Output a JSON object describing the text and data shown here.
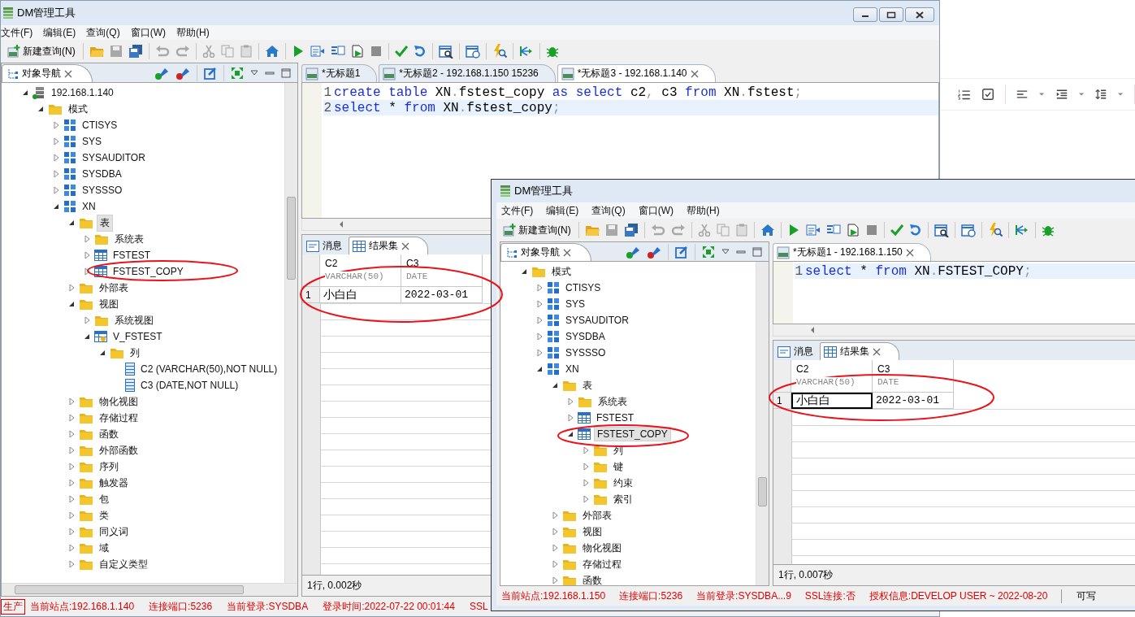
{
  "windows": [
    {
      "title": "DM管理工具",
      "title_buttons": true,
      "menu": [
        "文件(F)",
        "编辑(E)",
        "查询(Q)",
        "窗口(W)",
        "帮助(H)"
      ],
      "new_query": "新建查询(N)",
      "navigator": {
        "tab": "对象导航",
        "tree": [
          {
            "label": "192.168.1.140",
            "kind": "server",
            "expanded": true,
            "selected": false,
            "children": [
              {
                "label": "模式",
                "kind": "folder",
                "expanded": true,
                "selected": false,
                "children": [
                  {
                    "label": "CTISYS",
                    "kind": "schema",
                    "expanded": false,
                    "selected": false
                  },
                  {
                    "label": "SYS",
                    "kind": "schema",
                    "expanded": false,
                    "selected": false
                  },
                  {
                    "label": "SYSAUDITOR",
                    "kind": "schema",
                    "expanded": false,
                    "selected": false
                  },
                  {
                    "label": "SYSDBA",
                    "kind": "schema",
                    "expanded": false,
                    "selected": false
                  },
                  {
                    "label": "SYSSSO",
                    "kind": "schema",
                    "expanded": false,
                    "selected": false
                  },
                  {
                    "label": "XN",
                    "kind": "schema",
                    "expanded": true,
                    "selected": false,
                    "children": [
                      {
                        "label": "表",
                        "kind": "folder",
                        "expanded": true,
                        "selected": true,
                        "children": [
                          {
                            "label": "系统表",
                            "kind": "folder",
                            "expanded": false,
                            "selected": false
                          },
                          {
                            "label": "FSTEST",
                            "kind": "table",
                            "expanded": false,
                            "selected": false
                          },
                          {
                            "label": "FSTEST_COPY",
                            "kind": "table",
                            "expanded": false,
                            "selected": false
                          }
                        ]
                      },
                      {
                        "label": "外部表",
                        "kind": "folder",
                        "expanded": false,
                        "selected": false
                      },
                      {
                        "label": "视图",
                        "kind": "folder",
                        "expanded": true,
                        "selected": false,
                        "children": [
                          {
                            "label": "系统视图",
                            "kind": "folder",
                            "expanded": false,
                            "selected": false
                          },
                          {
                            "label": "V_FSTEST",
                            "kind": "view",
                            "expanded": true,
                            "selected": false,
                            "children": [
                              {
                                "label": "列",
                                "kind": "folder",
                                "expanded": true,
                                "selected": false,
                                "children": [
                                  {
                                    "label": "C2 (VARCHAR(50),NOT NULL)",
                                    "kind": "column",
                                    "selected": false
                                  },
                                  {
                                    "label": "C3 (DATE,NOT NULL)",
                                    "kind": "column",
                                    "selected": false
                                  }
                                ]
                              }
                            ]
                          }
                        ]
                      },
                      {
                        "label": "物化视图",
                        "kind": "folder",
                        "expanded": false,
                        "selected": false
                      },
                      {
                        "label": "存储过程",
                        "kind": "folder",
                        "expanded": false,
                        "selected": false
                      },
                      {
                        "label": "函数",
                        "kind": "folder",
                        "expanded": false,
                        "selected": false
                      },
                      {
                        "label": "外部函数",
                        "kind": "folder",
                        "expanded": false,
                        "selected": false
                      },
                      {
                        "label": "序列",
                        "kind": "folder",
                        "expanded": false,
                        "selected": false
                      },
                      {
                        "label": "触发器",
                        "kind": "folder",
                        "expanded": false,
                        "selected": false
                      },
                      {
                        "label": "包",
                        "kind": "folder",
                        "expanded": false,
                        "selected": false
                      },
                      {
                        "label": "类",
                        "kind": "folder",
                        "expanded": false,
                        "selected": false
                      },
                      {
                        "label": "同义词",
                        "kind": "folder",
                        "expanded": false,
                        "selected": false
                      },
                      {
                        "label": "域",
                        "kind": "folder",
                        "expanded": false,
                        "selected": false
                      },
                      {
                        "label": "自定义类型",
                        "kind": "folder",
                        "expanded": false,
                        "selected": false
                      }
                    ]
                  }
                ]
              }
            ]
          }
        ]
      },
      "editor": {
        "tabs": [
          {
            "label": "*无标题1",
            "selected": false
          },
          {
            "label": "*无标题2 - 192.168.1.150 15236",
            "selected": false
          },
          {
            "label": "*无标题3 - 192.168.1.140",
            "selected": true
          }
        ],
        "lines": [
          {
            "number": "1",
            "current": false,
            "tokens": [
              {
                "t": "create ",
                "kind": "keyword"
              },
              {
                "t": "table ",
                "kind": "keyword"
              },
              {
                "t": "XN",
                "kind": "plain"
              },
              {
                "t": ".",
                "kind": "punct"
              },
              {
                "t": "fstest_copy ",
                "kind": "plain"
              },
              {
                "t": "as ",
                "kind": "keyword"
              },
              {
                "t": "select ",
                "kind": "keyword"
              },
              {
                "t": "c2",
                "kind": "plain"
              },
              {
                "t": ",",
                "kind": "punct"
              },
              {
                "t": " c3 ",
                "kind": "plain"
              },
              {
                "t": "from",
                "kind": "keyword"
              },
              {
                "t": " XN",
                "kind": "plain"
              },
              {
                "t": ".",
                "kind": "punct"
              },
              {
                "t": "fstest",
                "kind": "plain"
              },
              {
                "t": ";",
                "kind": "punct"
              }
            ]
          },
          {
            "number": "2",
            "current": true,
            "tokens": [
              {
                "t": "select",
                "kind": "keyword"
              },
              {
                "t": " * ",
                "kind": "plain"
              },
              {
                "t": "from",
                "kind": "keyword"
              },
              {
                "t": " XN",
                "kind": "plain"
              },
              {
                "t": ".",
                "kind": "punct"
              },
              {
                "t": "fstest_copy",
                "kind": "plain"
              },
              {
                "t": ";",
                "kind": "punct"
              }
            ]
          }
        ]
      },
      "results": {
        "tabs": [
          {
            "label": "消息",
            "kind": "messages",
            "selected": false
          },
          {
            "label": "结果集",
            "kind": "resultset",
            "selected": true
          }
        ],
        "columns": [
          {
            "name": "C2",
            "type": "VARCHAR(50)"
          },
          {
            "name": "C3",
            "type": "DATE"
          }
        ],
        "rows": [
          {
            "number": "1",
            "cells": [
              {
                "text": "小白白",
                "selected": false
              },
              {
                "text": "2022-03-01",
                "selected": false
              }
            ]
          }
        ],
        "status": "1行, 0.002秒"
      },
      "status_bar": [
        {
          "text": "生产",
          "kind": "badge"
        },
        {
          "text": "当前站点:192.168.1.140",
          "kind": "info"
        },
        {
          "text": "连接端口:5236",
          "kind": "info"
        },
        {
          "text": "当前登录:SYSDBA",
          "kind": "info"
        },
        {
          "text": "登录时间:2022-07-22 00:01:44",
          "kind": "info"
        },
        {
          "text": "SSL",
          "kind": "info"
        }
      ]
    },
    {
      "title": "DM管理工具",
      "title_buttons": false,
      "menu": [
        "文件(F)",
        "编辑(E)",
        "查询(Q)",
        "窗口(W)",
        "帮助(H)"
      ],
      "new_query": "新建查询(N)",
      "navigator": {
        "tab": "对象导航",
        "tree": [
          {
            "label": "模式",
            "kind": "folder",
            "expanded": true,
            "selected": false,
            "children": [
              {
                "label": "CTISYS",
                "kind": "schema",
                "expanded": false,
                "selected": false
              },
              {
                "label": "SYS",
                "kind": "schema",
                "expanded": false,
                "selected": false
              },
              {
                "label": "SYSAUDITOR",
                "kind": "schema",
                "expanded": false,
                "selected": false
              },
              {
                "label": "SYSDBA",
                "kind": "schema",
                "expanded": false,
                "selected": false
              },
              {
                "label": "SYSSSO",
                "kind": "schema",
                "expanded": false,
                "selected": false
              },
              {
                "label": "XN",
                "kind": "schema",
                "expanded": true,
                "selected": false,
                "children": [
                  {
                    "label": "表",
                    "kind": "folder",
                    "expanded": true,
                    "selected": false,
                    "children": [
                      {
                        "label": "系统表",
                        "kind": "folder",
                        "expanded": false,
                        "selected": false
                      },
                      {
                        "label": "FSTEST",
                        "kind": "table",
                        "expanded": false,
                        "selected": false
                      },
                      {
                        "label": "FSTEST_COPY",
                        "kind": "table",
                        "expanded": true,
                        "selected": true,
                        "children": [
                          {
                            "label": "列",
                            "kind": "folder",
                            "expanded": false,
                            "selected": false
                          },
                          {
                            "label": "键",
                            "kind": "folder",
                            "expanded": false,
                            "selected": false
                          },
                          {
                            "label": "约束",
                            "kind": "folder",
                            "expanded": false,
                            "selected": false
                          },
                          {
                            "label": "索引",
                            "kind": "folder",
                            "expanded": false,
                            "selected": false
                          }
                        ]
                      }
                    ]
                  },
                  {
                    "label": "外部表",
                    "kind": "folder",
                    "expanded": false,
                    "selected": false
                  },
                  {
                    "label": "视图",
                    "kind": "folder",
                    "expanded": false,
                    "selected": false
                  },
                  {
                    "label": "物化视图",
                    "kind": "folder",
                    "expanded": false,
                    "selected": false
                  },
                  {
                    "label": "存储过程",
                    "kind": "folder",
                    "expanded": false,
                    "selected": false
                  },
                  {
                    "label": "函数",
                    "kind": "folder",
                    "expanded": false,
                    "selected": false
                  }
                ]
              }
            ]
          }
        ]
      },
      "editor": {
        "tabs": [
          {
            "label": "*无标题1 - 192.168.1.150",
            "selected": true
          }
        ],
        "lines": [
          {
            "number": "1",
            "current": true,
            "tokens": [
              {
                "t": "select",
                "kind": "keyword"
              },
              {
                "t": " * ",
                "kind": "plain"
              },
              {
                "t": "from",
                "kind": "keyword"
              },
              {
                "t": " XN",
                "kind": "plain"
              },
              {
                "t": ".",
                "kind": "punct"
              },
              {
                "t": "FSTEST_COPY",
                "kind": "plain"
              },
              {
                "t": ";",
                "kind": "punct"
              }
            ]
          }
        ]
      },
      "results": {
        "tabs": [
          {
            "label": "消息",
            "kind": "messages",
            "selected": false
          },
          {
            "label": "结果集",
            "kind": "resultset",
            "selected": true
          }
        ],
        "columns": [
          {
            "name": "C2",
            "type": "VARCHAR(50)"
          },
          {
            "name": "C3",
            "type": "DATE"
          }
        ],
        "rows": [
          {
            "number": "1",
            "cells": [
              {
                "text": "小白白",
                "selected": true
              },
              {
                "text": "2022-03-01",
                "selected": false
              }
            ]
          }
        ],
        "status": "1行, 0.007秒"
      },
      "status_bar": [
        {
          "text": "当前站点:192.168.1.150",
          "kind": "info"
        },
        {
          "text": "连接端口:5236",
          "kind": "info"
        },
        {
          "text": "当前登录:SYSDBA...9",
          "kind": "info"
        },
        {
          "text": "SSL连接:否",
          "kind": "info"
        },
        {
          "text": "授权信息:DEVELOP USER ~ 2022-08-20",
          "kind": "info"
        },
        {
          "text": "可写",
          "kind": "plain"
        }
      ]
    }
  ]
}
